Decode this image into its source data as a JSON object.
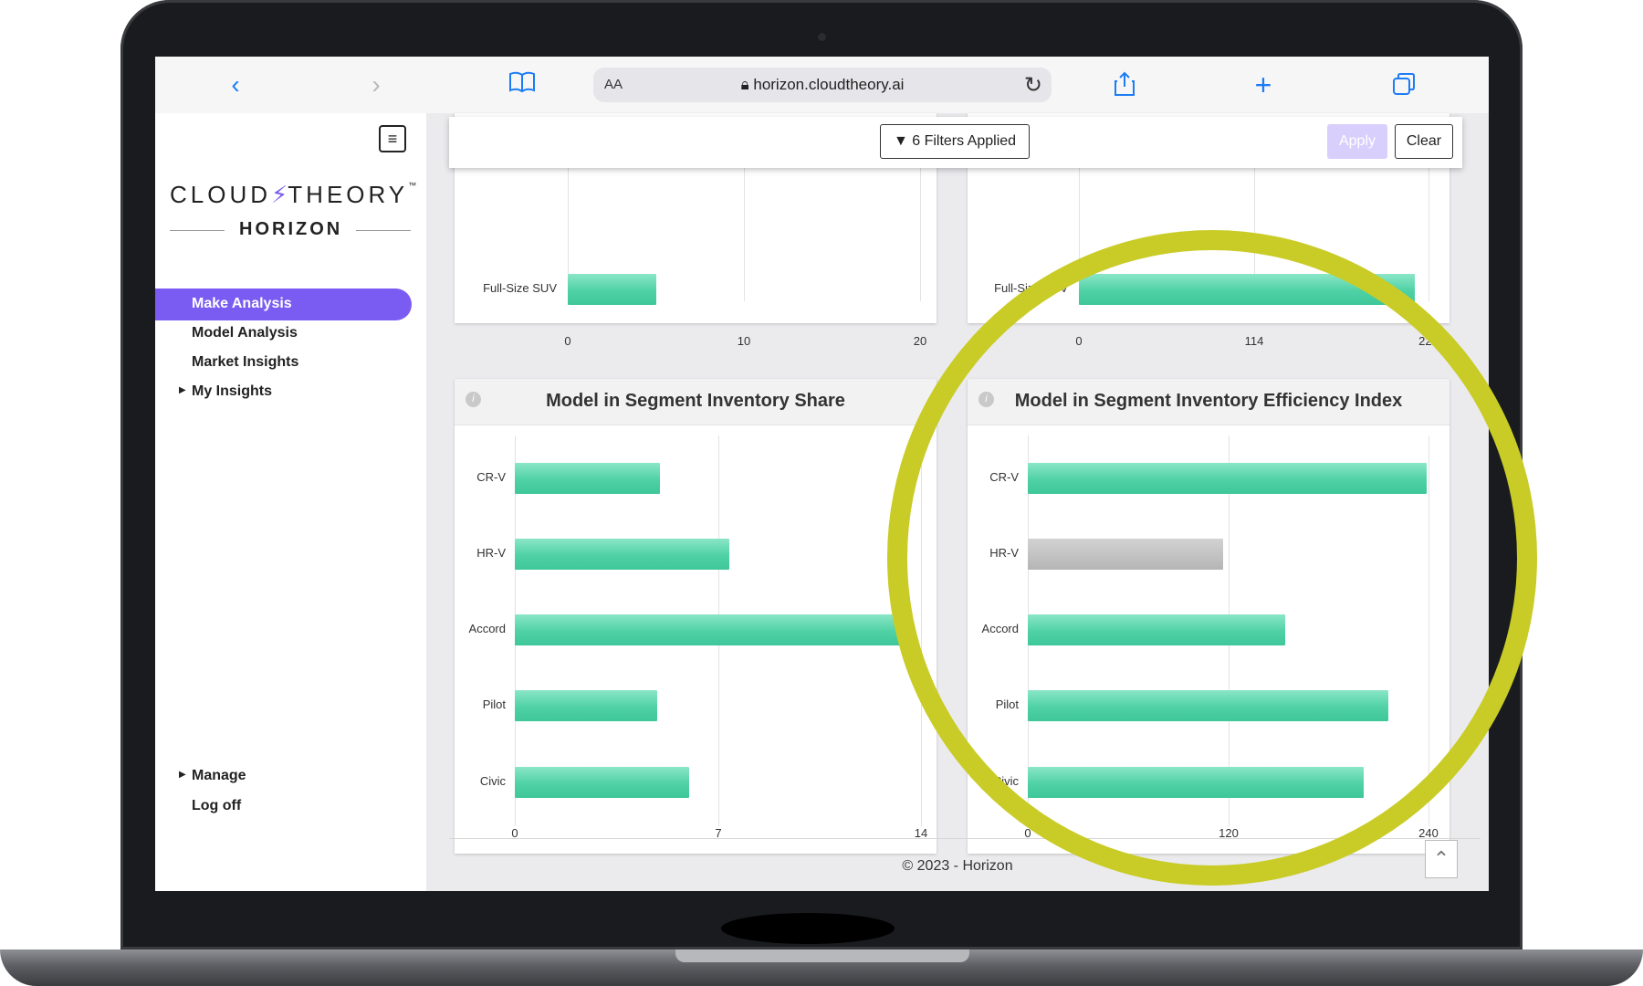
{
  "browser": {
    "text_size_label": "AA",
    "url": "horizon.cloudtheory.ai"
  },
  "logo": {
    "top": "CLOUD",
    "bolt": "⚡",
    "top2": "THEORY",
    "tm": "™",
    "bottom": "HORIZON"
  },
  "sidebar": {
    "items": [
      "Make Analysis",
      "Model Analysis",
      "Market Insights",
      "My Insights"
    ],
    "bottom_items": [
      "Manage",
      "Log off"
    ]
  },
  "filters": {
    "applied_label": "6 Filters Applied",
    "apply_label": "Apply",
    "clear_label": "Clear"
  },
  "footer": {
    "copyright": "© 2023 - Horizon"
  },
  "accent_color": "#7b5cf2",
  "highlight_circle_color": "#c9cc26",
  "chart_data": [
    {
      "type": "bar",
      "title": "",
      "categories": [
        "Full-Size SUV"
      ],
      "values": [
        5
      ],
      "xlim": [
        0,
        20
      ],
      "ticks": [
        "0",
        "10",
        "20"
      ]
    },
    {
      "type": "bar",
      "title": "",
      "categories": [
        "Full-Size SUV"
      ],
      "values": [
        219
      ],
      "xlim": [
        0,
        228
      ],
      "ticks": [
        "0",
        "114",
        "228"
      ]
    },
    {
      "type": "bar",
      "title": "Model in Segment Inventory Share",
      "categories": [
        "CR-V",
        "HR-V",
        "Accord",
        "Pilot",
        "Civic"
      ],
      "values": [
        5,
        7.4,
        13.5,
        4.9,
        6
      ],
      "xlim": [
        0,
        14
      ],
      "ticks": [
        "0",
        "7",
        "14"
      ]
    },
    {
      "type": "bar",
      "title": "Model in Segment Inventory Efficiency Index",
      "categories": [
        "CR-V",
        "HR-V",
        "Accord",
        "Pilot",
        "Civic"
      ],
      "values": [
        239,
        117,
        154,
        216,
        201
      ],
      "highlight_gray": [
        "HR-V"
      ],
      "xlim": [
        0,
        240
      ],
      "ticks": [
        "0",
        "120",
        "240"
      ]
    }
  ]
}
